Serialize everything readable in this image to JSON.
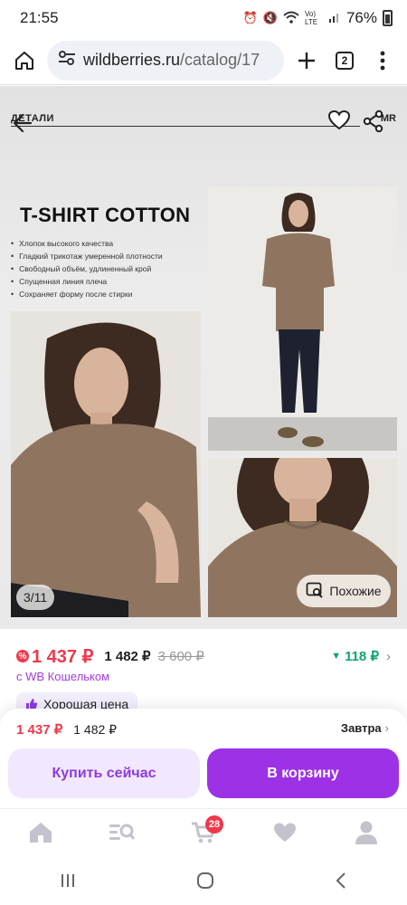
{
  "status_bar": {
    "time": "21:55",
    "network": "Vo) LTE",
    "battery": "76%"
  },
  "browser": {
    "url_host": "wildberries.ru",
    "url_path": "/catalog/17",
    "tab_count": "2"
  },
  "gallery": {
    "brand_left": "ДЕТАЛИ",
    "brand_right": "MR",
    "promo_title": "T-SHIRT COTTON",
    "promo_bullets": [
      "Хлопок высокого качества",
      "Гладкий трикотаж умеренной плотности",
      "Свободный объём, удлиненный крой",
      "Спущенная линия плеча",
      "Сохраняет форму после стирки"
    ],
    "counter": "3/11",
    "similar_label": "Похожие"
  },
  "price": {
    "wallet_price": "1 437 ₽",
    "wb_price": "1 482 ₽",
    "old_price": "3 600 ₽",
    "cashback": "118 ₽",
    "wallet_note": "с WB Кошельком",
    "good_price": "Хорошая цена"
  },
  "bottom_panel": {
    "price_red": "1 437 ₽",
    "price_black": "1 482 ₽",
    "delivery": "Завтра",
    "buy_now": "Купить сейчас",
    "add_to_cart": "В корзину"
  },
  "tabbar": {
    "cart_count": "28"
  },
  "colors": {
    "accent": "#9d31e6",
    "price_red": "#f0384c",
    "cashback_green": "#12a36b",
    "shirt": "#8f7560"
  },
  "icons": [
    "home-icon",
    "settings-tune-icon",
    "plus-icon",
    "tabs-icon",
    "menu-dots-icon",
    "back-arrow-icon",
    "heart-icon",
    "share-icon",
    "image-search-icon",
    "catalog-search-icon",
    "cart-icon",
    "profile-icon",
    "recent-apps-icon",
    "home-circle-icon",
    "back-chevron-icon"
  ]
}
